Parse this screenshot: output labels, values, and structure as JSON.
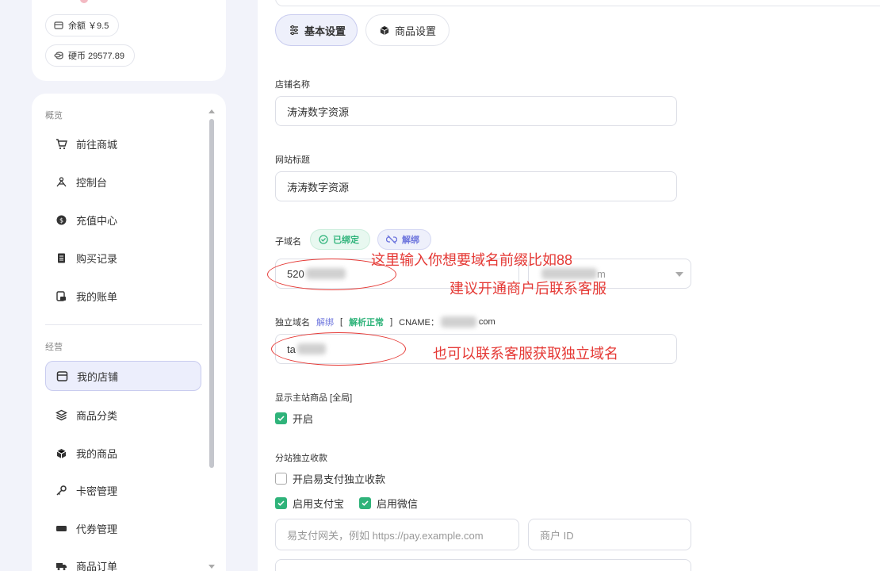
{
  "account": {
    "balance": "余额 ￥9.5",
    "coins": "硬币 29577.89"
  },
  "sidebar": {
    "section_overview": "概览",
    "section_business": "经营",
    "items": [
      {
        "label": "前往商城"
      },
      {
        "label": "控制台"
      },
      {
        "label": "充值中心"
      },
      {
        "label": "购买记录"
      },
      {
        "label": "我的账单"
      },
      {
        "label": "我的店铺"
      },
      {
        "label": "商品分类"
      },
      {
        "label": "我的商品"
      },
      {
        "label": "卡密管理"
      },
      {
        "label": "代券管理"
      },
      {
        "label": "商品订单"
      }
    ]
  },
  "tabs": {
    "basic": "基本设置",
    "goods": "商品设置"
  },
  "form": {
    "store_name_label": "店铺名称",
    "store_name_value": "涛涛数字资源",
    "site_title_label": "网站标题",
    "site_title_value": "涛涛数字资源",
    "subdomain_label": "子域名",
    "bound_badge": "已绑定",
    "unbind_badge": "解绑",
    "subdomain_value": "520",
    "subdomain_suffix": "m",
    "custom_domain_label": "独立域名",
    "custom_unbind": "解绑",
    "bracket_open": "[",
    "resolve_ok": "解析正常",
    "bracket_close": "]",
    "cname": "CNAME：",
    "cname_suffix": "com",
    "custom_domain_value": "ta",
    "show_main_label": "显示主站商品 [全局]",
    "show_main_option": "开启",
    "sub_payment_label": "分站独立收款",
    "epay_option": "开启易支付独立收款",
    "alipay_option": "启用支付宝",
    "wechat_option": "启用微信",
    "gateway_placeholder": "易支付网关，例如 https://pay.example.com",
    "merchant_placeholder": "商户 ID"
  },
  "annotations": {
    "line1": "这里输入你想要域名前缀比如88",
    "line2": "建议开通商户后联系客服",
    "line3": "也可以联系客服获取独立域名"
  },
  "colors": {
    "accent": "#6c74dd",
    "success": "#2fb37a",
    "annotation": "#e53935"
  }
}
